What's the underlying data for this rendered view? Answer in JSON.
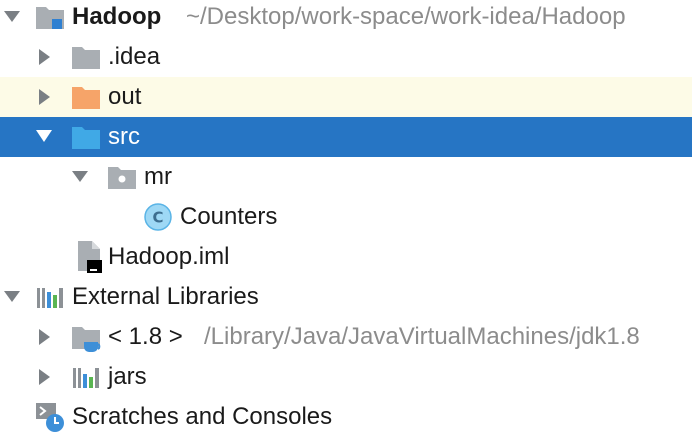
{
  "colors": {
    "selection": "#2675c4",
    "excluded_row": "#fdfbe7",
    "folder_gray": "#a9aeb3",
    "folder_orange": "#f6a469",
    "folder_blue": "#40a9e6",
    "path_gray": "#8c8c8c"
  },
  "tree": {
    "root": {
      "label": "Hadoop",
      "path": "~/Desktop/work-space/work-idea/Hadoop",
      "icon": "module-folder-icon",
      "expanded": true
    },
    "idea": {
      "label": ".idea",
      "icon": "folder-icon",
      "expanded": false
    },
    "out": {
      "label": "out",
      "icon": "excluded-folder-icon",
      "expanded": false
    },
    "src": {
      "label": "src",
      "icon": "source-folder-icon",
      "expanded": true,
      "selected": true
    },
    "mr": {
      "label": "mr",
      "icon": "package-icon",
      "expanded": true
    },
    "counters": {
      "label": "Counters",
      "icon": "class-icon",
      "icon_letter": "C"
    },
    "iml": {
      "label": "Hadoop.iml",
      "icon": "iml-file-icon"
    },
    "external_libraries": {
      "label": "External Libraries",
      "icon": "libraries-icon",
      "expanded": true
    },
    "jdk": {
      "label": "< 1.8 >",
      "path": "/Library/Java/JavaVirtualMachines/jdk1.8",
      "icon": "jdk-icon",
      "expanded": false
    },
    "jars": {
      "label": "jars",
      "icon": "jars-library-icon",
      "expanded": false
    },
    "scratches": {
      "label": "Scratches and Consoles",
      "icon": "scratches-icon"
    }
  }
}
